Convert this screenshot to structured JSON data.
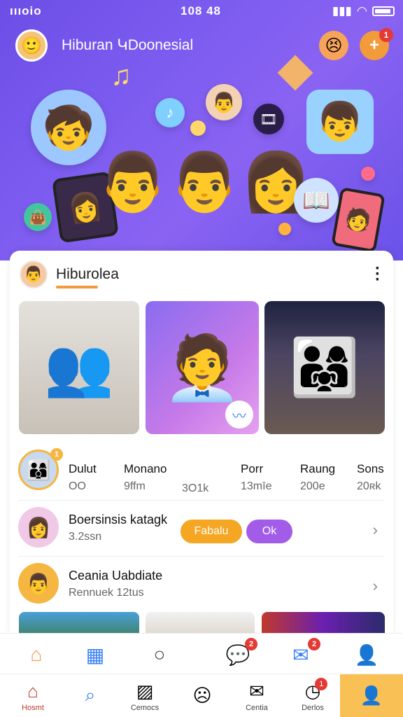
{
  "status_bar": {
    "left": "ıııoio",
    "time": "108 48"
  },
  "app": {
    "title": "Hiburan ԿDoonesial",
    "avatar_icon": "user-avatar",
    "add_badge": "1"
  },
  "card": {
    "title": "Hiburolea",
    "menu": "⋮"
  },
  "stats": {
    "badge": "1",
    "items": [
      {
        "key": "Dulut",
        "value": "OO"
      },
      {
        "key": "Monano",
        "value": "9ffm"
      },
      {
        "key": "",
        "value": "3O1k"
      },
      {
        "key": "Porr",
        "value": "13mīe"
      },
      {
        "key": "Raung",
        "value": "200e"
      },
      {
        "key": "Sons",
        "value": "20ʀk"
      }
    ]
  },
  "rows": [
    {
      "title": "Boersinsis katagk",
      "sub": "3.2ssn",
      "pill1": "Fabalu",
      "pill2": "Ok"
    },
    {
      "title": "Ceania Uabdiate",
      "sub": "Rennuek 12tus"
    }
  ],
  "nav_top": {
    "badges": [
      "2",
      "2"
    ]
  },
  "nav_bottom": {
    "items": [
      {
        "label": "Hosmt"
      },
      {
        "label": ""
      },
      {
        "label": "Cemocs"
      },
      {
        "label": ""
      },
      {
        "label": "Centia"
      },
      {
        "label": "Derlos",
        "badge": "1"
      },
      {
        "label": ""
      }
    ]
  },
  "colors": {
    "accent": "#f5b642",
    "purple": "#7c5cf0",
    "pill_orange": "#f5a623",
    "pill_purple": "#a25ce8"
  }
}
